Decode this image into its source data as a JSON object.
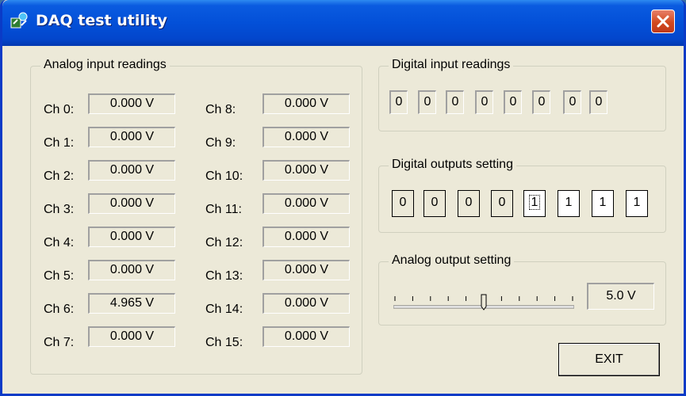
{
  "window": {
    "title": "DAQ test utility",
    "icon": "daq-app-icon",
    "close_icon": "close-icon"
  },
  "analog_inputs": {
    "legend": "Analog input readings",
    "channels": [
      {
        "label": "Ch 0:",
        "value": "0.000 V"
      },
      {
        "label": "Ch 1:",
        "value": "0.000 V"
      },
      {
        "label": "Ch 2:",
        "value": "0.000 V"
      },
      {
        "label": "Ch 3:",
        "value": "0.000 V"
      },
      {
        "label": "Ch 4:",
        "value": "0.000 V"
      },
      {
        "label": "Ch 5:",
        "value": "0.000 V"
      },
      {
        "label": "Ch 6:",
        "value": "4.965 V"
      },
      {
        "label": "Ch 7:",
        "value": "0.000 V"
      },
      {
        "label": "Ch  8:",
        "value": "0.000 V"
      },
      {
        "label": "Ch  9:",
        "value": "0.000 V"
      },
      {
        "label": "Ch 10:",
        "value": "0.000 V"
      },
      {
        "label": "Ch 11:",
        "value": "0.000 V"
      },
      {
        "label": "Ch 12:",
        "value": "0.000 V"
      },
      {
        "label": "Ch 13:",
        "value": "0.000 V"
      },
      {
        "label": "Ch 14:",
        "value": "0.000 V"
      },
      {
        "label": "Ch 15:",
        "value": "0.000 V"
      }
    ]
  },
  "digital_inputs": {
    "legend": "Digital input readings",
    "bits": [
      "0",
      "0",
      "0",
      "0",
      "0",
      "0",
      "0",
      "0"
    ]
  },
  "digital_outputs": {
    "legend": "Digital outputs setting",
    "bits": [
      "0",
      "0",
      "0",
      "0",
      "1",
      "1",
      "1",
      "1"
    ],
    "focused_index": 4
  },
  "analog_output": {
    "legend": "Analog output setting",
    "value": "5.0 V",
    "slider_fraction": 0.5,
    "tick_count": 11
  },
  "buttons": {
    "exit": "EXIT"
  }
}
